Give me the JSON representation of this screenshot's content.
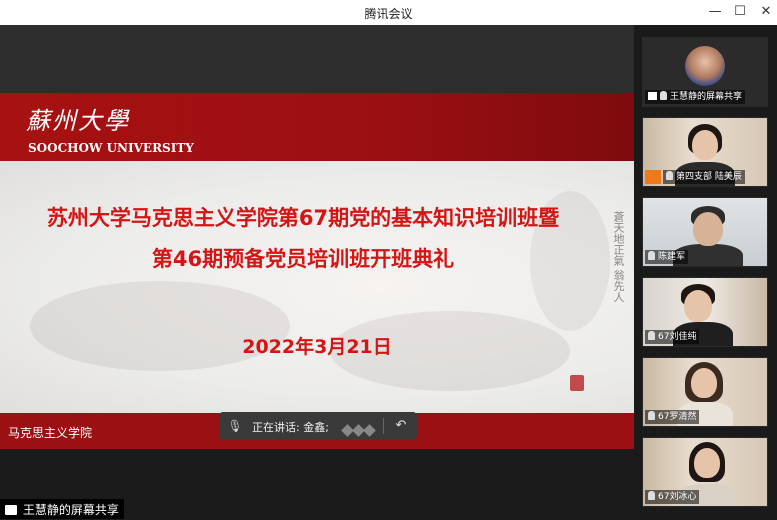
{
  "window": {
    "title": "腾讯会议",
    "minimize_icon": "minimize-icon",
    "maximize_icon": "maximize-icon",
    "close_icon": "close-icon"
  },
  "slide": {
    "logo_text": "蘇州大學",
    "university": "SOOCHOW UNIVERSITY",
    "headline_line1": "苏州大学马克思主义学院第67期党的基本知识培训班暨",
    "headline_line2": "第46期预备党员培训班开班典礼",
    "date": "2022年3月21日",
    "footer_dept": "马克思主义学院",
    "calligraphy": "蒼天地正氣 翁先人",
    "colors": {
      "banner": "#9b0f12",
      "headline": "#d41515"
    }
  },
  "speaking_bar": {
    "label": "正在讲话: 金鑫;",
    "mic_icon": "mic-muted-icon",
    "exit_icon": "return-arrow-icon"
  },
  "share_label": {
    "text": "王慧静的屏幕共享"
  },
  "participants": [
    {
      "name": "王慧静的屏幕共享",
      "type": "screen-share"
    },
    {
      "name": "第四支部 陆美辰",
      "type": "video"
    },
    {
      "name": "陈建军",
      "type": "video"
    },
    {
      "name": "67刘佳纯",
      "type": "video"
    },
    {
      "name": "67罗清然",
      "type": "video"
    },
    {
      "name": "67刘冰心",
      "type": "video"
    }
  ]
}
